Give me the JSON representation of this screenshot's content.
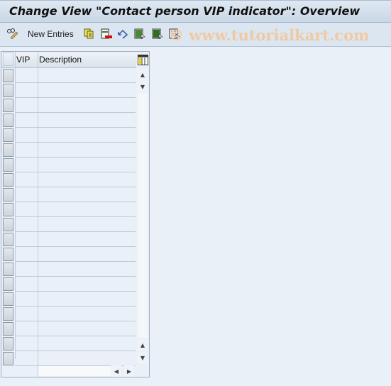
{
  "title": "Change View \"Contact person VIP indicator\": Overview",
  "toolbar": {
    "new_entries_label": "New Entries",
    "icons": [
      "edit-glasses-icon",
      "copy-icon",
      "delete-icon",
      "undo-icon",
      "select-all-icon",
      "select-block-icon",
      "deselect-all-icon"
    ]
  },
  "watermark": "© www.tutorialkart.com",
  "table": {
    "columns": [
      "VIP",
      "Description"
    ],
    "row_count": 20,
    "rows": []
  }
}
